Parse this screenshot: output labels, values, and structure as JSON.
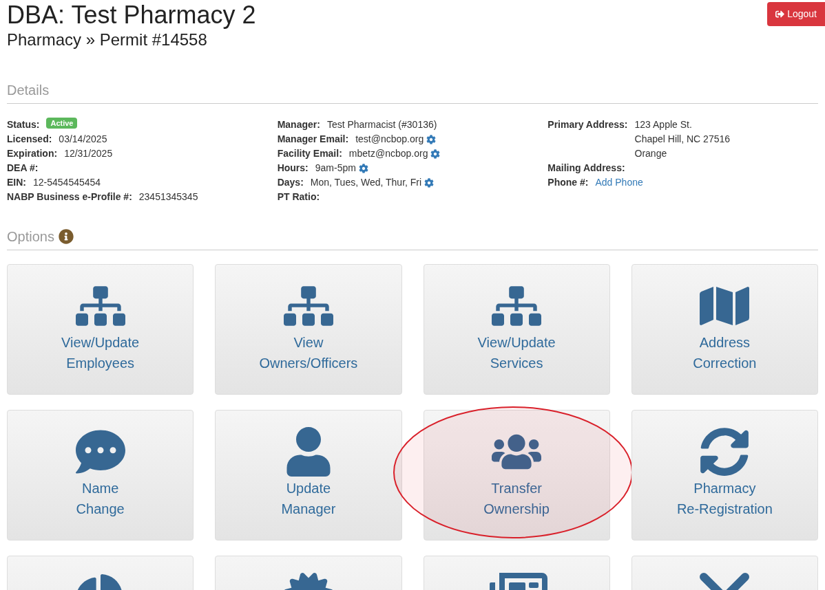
{
  "header": {
    "title": "DBA: Test Pharmacy 2",
    "breadcrumb": "Pharmacy » Permit #14558",
    "logout": "Logout"
  },
  "details": {
    "heading": "Details",
    "columns": [
      [
        {
          "label": "Status:",
          "kind": "badge",
          "value": [
            "Active"
          ],
          "gear": false
        },
        {
          "label": "Licensed:",
          "kind": "text",
          "value": [
            "03/14/2025"
          ],
          "gear": false
        },
        {
          "label": "Expiration:",
          "kind": "text",
          "value": [
            "12/31/2025"
          ],
          "gear": false
        },
        {
          "label": "DEA #:"
        },
        {
          "label": "EIN:",
          "kind": "text",
          "value": [
            "12-5454545454"
          ],
          "gear": false
        },
        {
          "label": "NABP Business e-Profile #:",
          "kind": "text",
          "value": [
            "23451345345"
          ],
          "gear": false
        }
      ],
      [
        {
          "label": "Manager:",
          "kind": "text",
          "value": [
            "Test Pharmacist (#30136)"
          ],
          "gear": false
        },
        {
          "label": "Manager Email:",
          "kind": "text",
          "value": [
            "test@ncbop.org"
          ],
          "gear": true
        },
        {
          "label": "Facility Email:",
          "kind": "text",
          "value": [
            "mbetz@ncbop.org"
          ],
          "gear": true
        },
        {
          "label": "Hours:",
          "kind": "text",
          "value": [
            "9am-5pm"
          ],
          "gear": true
        },
        {
          "label": "Days:",
          "kind": "text",
          "value": [
            "Mon, Tues, Wed, Thur, Fri"
          ],
          "gear": true
        },
        {
          "label": "PT Ratio:"
        }
      ],
      [
        {
          "label": "Primary Address:",
          "kind": "text",
          "value": [
            "123 Apple St.",
            "Chapel Hill, NC 27516",
            "Orange"
          ],
          "gear": false
        },
        {
          "label": "Mailing Address:"
        },
        {
          "label": "Phone #:",
          "kind": "link",
          "value": [
            "Add Phone"
          ],
          "gear": false
        }
      ]
    ]
  },
  "options": {
    "heading": "Options",
    "tiles": [
      {
        "kind": "sitemap",
        "lines": [
          "View/Update",
          "Employees"
        ],
        "highlighted": false
      },
      {
        "kind": "sitemap",
        "lines": [
          "View",
          "Owners/Officers"
        ],
        "highlighted": false
      },
      {
        "kind": "sitemap",
        "lines": [
          "View/Update",
          "Services"
        ],
        "highlighted": false
      },
      {
        "kind": "map",
        "lines": [
          "Address",
          "Correction"
        ],
        "highlighted": false
      },
      {
        "kind": "comment",
        "lines": [
          "Name",
          "Change"
        ],
        "highlighted": false
      },
      {
        "kind": "user",
        "lines": [
          "Update",
          "Manager"
        ],
        "highlighted": false
      },
      {
        "kind": "users",
        "lines": [
          "Transfer",
          "Ownership"
        ],
        "highlighted": true
      },
      {
        "kind": "sync",
        "lines": [
          "Pharmacy",
          "Re-Registration"
        ],
        "highlighted": false
      },
      {
        "kind": "pie",
        "highlighted": false
      },
      {
        "kind": "certificate",
        "highlighted": false
      },
      {
        "kind": "newspaper",
        "highlighted": false
      },
      {
        "kind": "times",
        "highlighted": false
      }
    ]
  }
}
